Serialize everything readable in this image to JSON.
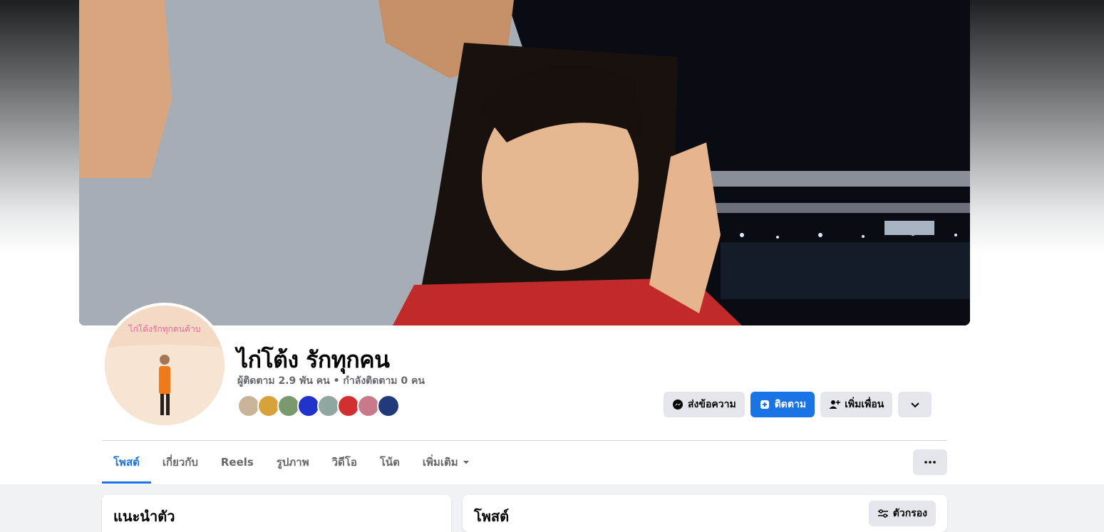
{
  "profile": {
    "name": "ไก่โต้ง รักทุกคน",
    "stats": "ผู้ติดตาม 2.9 พัน คน • กำลังติดตาม 0 คน",
    "avatar_caption": "ไก่โต้งรักทุกคนค้าบ"
  },
  "actions": {
    "message_label": "ส่งข้อความ",
    "follow_label": "ติดตาม",
    "add_friend_label": "เพิ่มเพื่อน"
  },
  "tabs": [
    {
      "label": "โพสต์",
      "active": true
    },
    {
      "label": "เกี่ยวกับ"
    },
    {
      "label": "Reels"
    },
    {
      "label": "รูปภาพ"
    },
    {
      "label": "วิดีโอ"
    },
    {
      "label": "โน้ต"
    },
    {
      "label": "เพิ่มเติม"
    }
  ],
  "intro": {
    "title": "แนะนำตัว"
  },
  "posts": {
    "title": "โพสต์",
    "filter_label": "ตัวกรอง"
  },
  "colors": {
    "accent": "#1b74e4",
    "button_bg": "#e4e6eb",
    "muted_text": "#65676b"
  },
  "friend_avatars": [
    "#c9b49a",
    "#d8a23a",
    "#7a9a6e",
    "#2233cc",
    "#8fa7a0",
    "#d23030",
    "#c87a8a",
    "#223a7a"
  ]
}
